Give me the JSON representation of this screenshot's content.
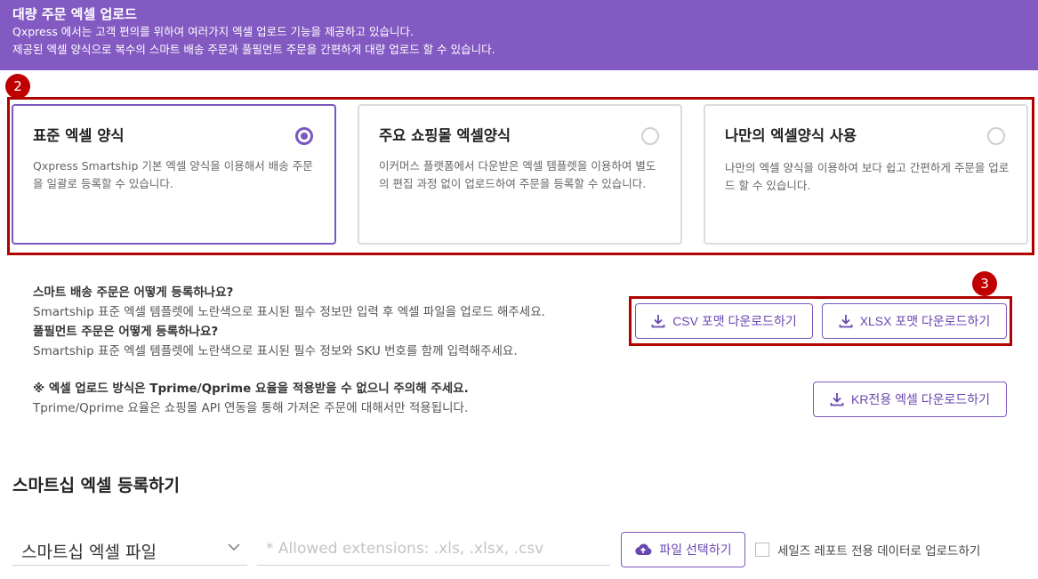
{
  "banner": {
    "title": "대량 주문 엑셀 업로드",
    "line1": "Qxpress 에서는 고객 편의를 위하여 여러가지 엑셀 업로드 기능을 제공하고 있습니다.",
    "line2": "제공된 엑셀 양식으로 복수의 스마트 배송 주문과 풀필먼트 주문을 간편하게 대량 업로드 할 수 있습니다.",
    "background": "#8359c2"
  },
  "markers": {
    "m2": "2",
    "m3": "3"
  },
  "cards": [
    {
      "title": "표준 엑셀 양식",
      "desc": "Qxpress Smartship 기본 엑셀 양식을 이용해서 배송 주문을 일괄로 등록할 수 있습니다.",
      "selected": true
    },
    {
      "title": "주요 쇼핑몰 엑셀양식",
      "desc": "이커머스 플랫폼에서 다운받은 엑셀 템플렛을 이용하여 별도의 편집 과정 없이 업로드하여 주문을 등록할 수 있습니다.",
      "selected": false
    },
    {
      "title": "나만의 엑셀양식 사용",
      "desc": "나만의 엑셀 양식을 이용하여 보다 쉽고 간편하게 주문을 업로드 할 수 있습니다.",
      "selected": false
    }
  ],
  "info": {
    "q1": "스마트 배송 주문은 어떻게 등록하나요?",
    "a1": "Smartship 표준 엑셀 템플렛에 노란색으로 표시된 필수 정보만 입력 후 엑셀 파일을 업로드 해주세요.",
    "q2": "풀필먼트 주문은 어떻게 등록하나요?",
    "a2": "Smartship 표준 엑셀 템플렛에 노란색으로 표시된 필수 정보와 SKU 번호를 함께 입력해주세요.",
    "notice": "※ 엑셀 업로드 방식은 Tprime/Qprime 요율을 적용받을 수 없으니 주의해 주세요.",
    "notice_detail": "Tprime/Qprime 요율은 쇼핑몰 API 연동을 통해 가져온 주문에 대해서만 적용됩니다."
  },
  "buttons": {
    "csv": "CSV 포맷 다운로드하기",
    "xlsx": "XLSX 포맷 다운로드하기",
    "kr": "KR전용 엑셀 다운로드하기",
    "file_select": "파일 선택하기"
  },
  "upload": {
    "section_title": "스마트십 엑셀 등록하기",
    "type_value": "스마트십 엑셀 파일",
    "file_placeholder": "* Allowed extensions: .xls, .xlsx, .csv",
    "checkbox_label": "세일즈 레포트 전용 데이터로 업로드하기"
  },
  "colors": {
    "accent": "#7a58bf",
    "highlight": "#b00000"
  },
  "icons": {
    "download": "download-icon",
    "upload": "cloud-upload-icon",
    "chevron": "chevron-down-icon"
  }
}
